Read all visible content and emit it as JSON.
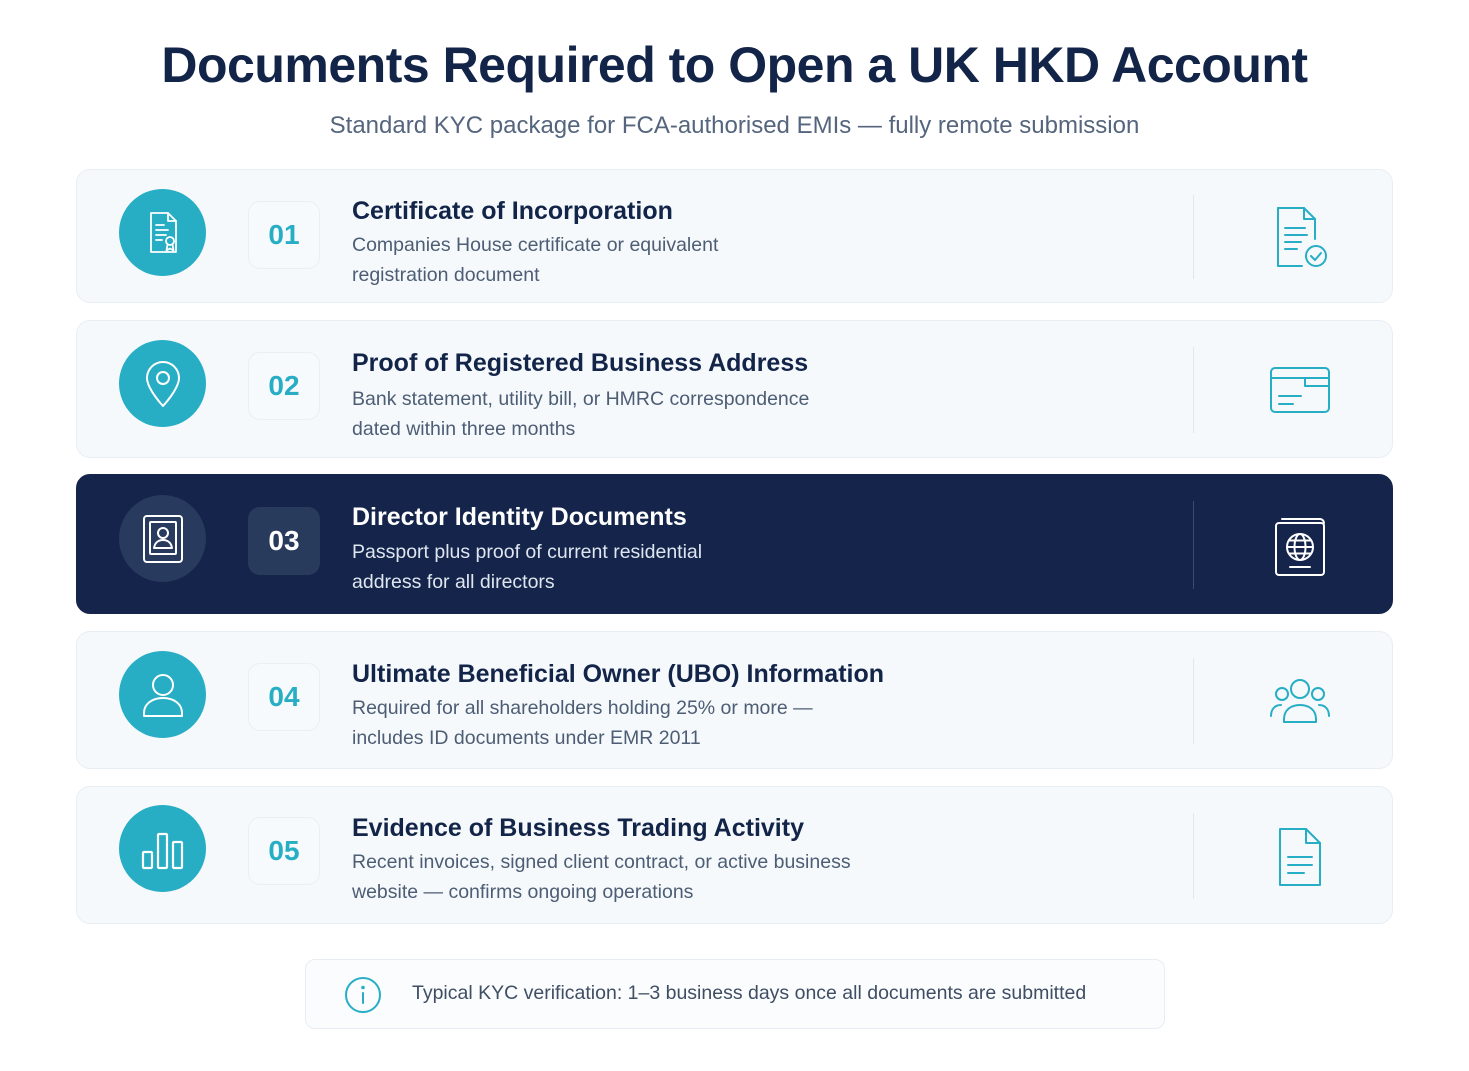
{
  "header": {
    "title": "Documents Required to Open a UK HKD Account",
    "subtitle": "Standard KYC package for FCA-authorised EMIs — fully remote submission"
  },
  "colors": {
    "accent": "#27aec5",
    "navy": "#14244a",
    "card_bg": "#f5f9fc",
    "text_dark": "#132449",
    "text_muted": "#4d5d74"
  },
  "documents": [
    {
      "number": "01",
      "title": "Certificate of Incorporation",
      "desc_line1": "Companies House certificate or equivalent",
      "desc_line2": "registration document",
      "left_icon": "certificate-icon",
      "right_icon": "document-check-icon"
    },
    {
      "number": "02",
      "title": "Proof of Registered Business Address",
      "desc_line1": "Bank statement, utility bill, or HMRC correspondence",
      "desc_line2": "dated within three months",
      "left_icon": "map-pin-icon",
      "right_icon": "statement-icon"
    },
    {
      "number": "03",
      "title": "Director Identity Documents",
      "desc_line1": "Passport plus proof of current residential",
      "desc_line2": "address for all directors",
      "left_icon": "id-card-icon",
      "right_icon": "passport-icon",
      "highlighted": true
    },
    {
      "number": "04",
      "title": "Ultimate Beneficial Owner (UBO) Information",
      "desc_line1": "Required for all shareholders holding 25% or more —",
      "desc_line2": "includes ID documents under EMR 2011",
      "left_icon": "user-icon",
      "right_icon": "users-group-icon"
    },
    {
      "number": "05",
      "title": "Evidence of Business Trading Activity",
      "desc_line1": "Recent invoices, signed client contract, or active business",
      "desc_line2": "website — confirms ongoing operations",
      "left_icon": "bar-chart-icon",
      "right_icon": "document-icon"
    }
  ],
  "note": {
    "icon": "info-icon",
    "text": "Typical KYC verification: 1–3 business days once all documents are submitted"
  }
}
